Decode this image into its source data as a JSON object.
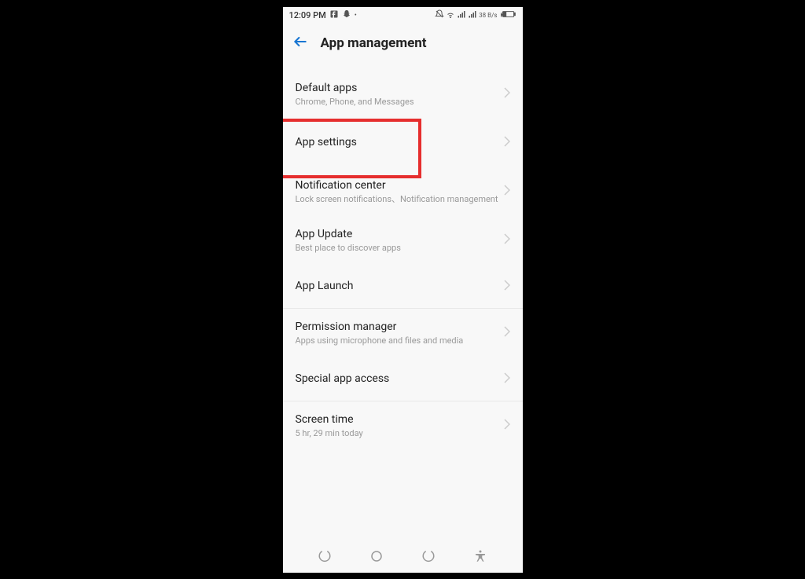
{
  "status": {
    "time": "12:09 PM",
    "speed": "38 B/s"
  },
  "header": {
    "title": "App management"
  },
  "items": [
    {
      "title": "Default apps",
      "sub": "Chrome, Phone, and Messages"
    },
    {
      "title": "App settings",
      "sub": ""
    },
    {
      "title": "Notification center",
      "sub": "Lock screen notifications、Notification management"
    },
    {
      "title": "App Update",
      "sub": "Best place to discover apps"
    },
    {
      "title": "App Launch",
      "sub": ""
    },
    {
      "title": "Permission manager",
      "sub": "Apps using microphone and files and media"
    },
    {
      "title": "Special app access",
      "sub": ""
    },
    {
      "title": "Screen time",
      "sub": "5 hr, 29 min today"
    }
  ]
}
